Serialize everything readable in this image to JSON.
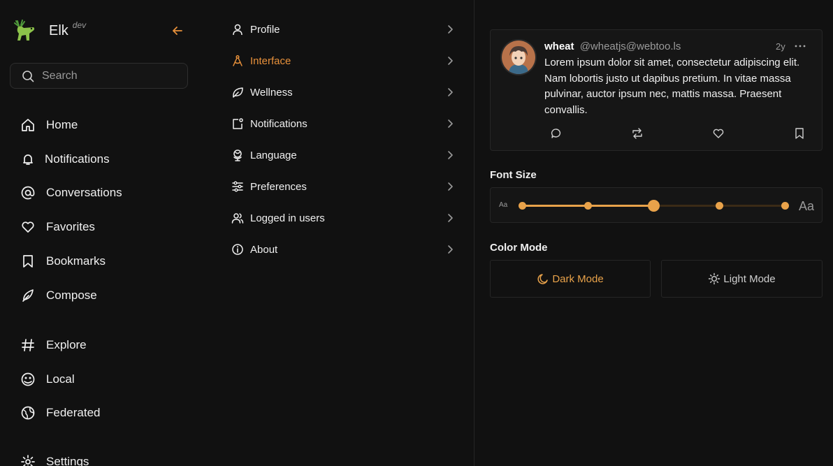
{
  "brand": {
    "name": "Elk",
    "tag": "dev"
  },
  "search": {
    "placeholder": "Search"
  },
  "nav": [
    {
      "label": "Home",
      "icon": "home-icon"
    },
    {
      "label": "Notifications",
      "icon": "bell-icon"
    },
    {
      "label": "Conversations",
      "icon": "at-icon"
    },
    {
      "label": "Favorites",
      "icon": "heart-icon"
    },
    {
      "label": "Bookmarks",
      "icon": "bookmark-icon"
    },
    {
      "label": "Compose",
      "icon": "feather-icon"
    },
    {
      "label": "Explore",
      "icon": "hash-icon"
    },
    {
      "label": "Local",
      "icon": "local-icon"
    },
    {
      "label": "Federated",
      "icon": "globe-icon"
    },
    {
      "label": "Settings",
      "icon": "gear-icon"
    }
  ],
  "settings": [
    {
      "label": "Profile",
      "icon": "user-icon"
    },
    {
      "label": "Interface",
      "icon": "compass-icon",
      "active": true
    },
    {
      "label": "Wellness",
      "icon": "leaf-icon"
    },
    {
      "label": "Notifications",
      "icon": "notification-icon"
    },
    {
      "label": "Language",
      "icon": "language-icon"
    },
    {
      "label": "Preferences",
      "icon": "sliders-icon"
    },
    {
      "label": "Logged in users",
      "icon": "users-icon"
    },
    {
      "label": "About",
      "icon": "info-icon"
    }
  ],
  "post": {
    "display_name": "wheat",
    "handle": "@wheatjs@webtoo.ls",
    "time": "2y",
    "body": "Lorem ipsum dolor sit amet, consectetur adipiscing elit. Nam lobortis justo ut dapibus pretium. In vitae massa pulvinar, auctor ipsum nec, mattis massa. Praesent convallis."
  },
  "font_size": {
    "title": "Font Size",
    "small_label": "Aa",
    "large_label": "Aa",
    "steps": 5,
    "selected_index": 2
  },
  "color_mode": {
    "title": "Color Mode",
    "dark_label": "Dark Mode",
    "light_label": "Light Mode",
    "selected": "dark"
  },
  "colors": {
    "accent": "#e8913b",
    "background": "#111111"
  }
}
